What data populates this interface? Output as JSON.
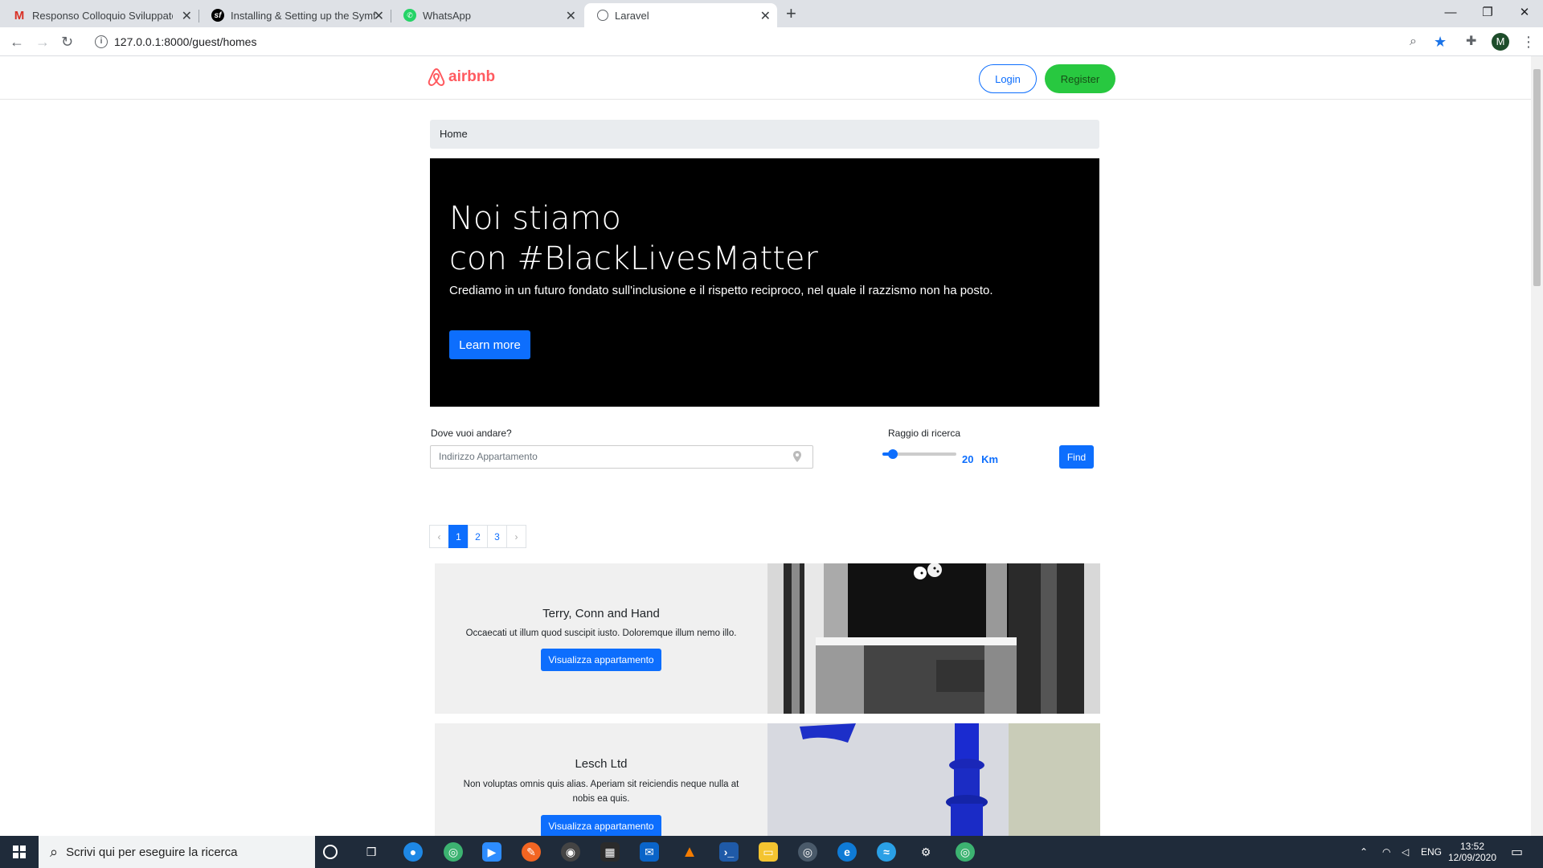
{
  "browser": {
    "tabs": [
      {
        "title": "Responso Colloquio Sviluppatore",
        "icon": "gmail-icon"
      },
      {
        "title": "Installing & Setting up the Symfony",
        "icon": "symfony-icon"
      },
      {
        "title": "WhatsApp",
        "icon": "whatsapp-icon"
      },
      {
        "title": "Laravel",
        "icon": "globe-icon"
      }
    ],
    "url": "127.0.0.1:8000/guest/homes",
    "profile_initial": "M"
  },
  "nav": {
    "logo_text": "airbnb",
    "login_label": "Login",
    "register_label": "Register"
  },
  "breadcrumb": {
    "home": "Home"
  },
  "hero": {
    "title_line1": "Noi stiamo",
    "title_line2": "con #BlackLivesMatter",
    "subtitle": "Crediamo in un futuro fondato sull'inclusione e il rispetto reciproco, nel quale il razzismo non ha posto.",
    "button": "Learn more"
  },
  "search": {
    "where_label": "Dove vuoi andare?",
    "where_placeholder": "Indirizzo Appartamento",
    "radius_label": "Raggio di ricerca",
    "radius_value": "20",
    "radius_unit": "Km",
    "radius_slider_fraction": 0.1,
    "find_label": "Find"
  },
  "pagination": {
    "prev": "‹",
    "pages": [
      "1",
      "2",
      "3"
    ],
    "active": "1",
    "next": "›"
  },
  "listings": [
    {
      "title": "Terry, Conn and Hand",
      "description": "Occaecati ut illum quod suscipit iusto. Doloremque illum nemo illo.",
      "button": "Visualizza appartamento"
    },
    {
      "title": "Lesch Ltd",
      "description": "Non voluptas omnis quis alias. Aperiam sit reiciendis neque nulla at nobis ea quis.",
      "button": "Visualizza appartamento"
    }
  ],
  "taskbar": {
    "search_placeholder": "Scrivi qui per eseguire la ricerca",
    "language": "ENG",
    "time": "13:52",
    "date": "12/09/2020"
  },
  "colors": {
    "brand": "#ff5a5f",
    "primary": "#0d6efd",
    "register": "#28c840"
  }
}
